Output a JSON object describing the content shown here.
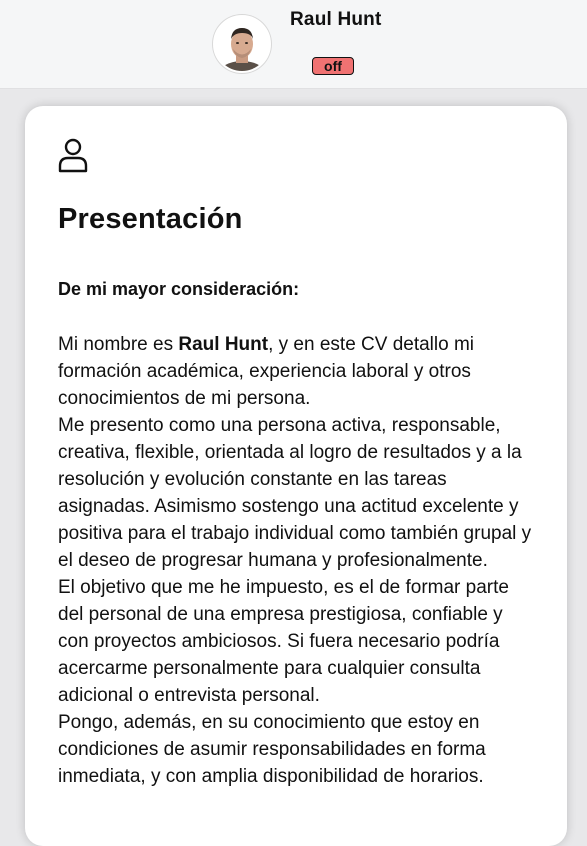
{
  "header": {
    "user_name": "Raul Hunt",
    "status": "off",
    "status_color": "#f07272"
  },
  "presentation": {
    "icon": "person-icon",
    "title": "Presentación",
    "salutation": "De mi mayor consideración:",
    "paragraph1_before": "Mi nombre es ",
    "paragraph1_name": "Raul Hunt",
    "paragraph1_after": ", y en este CV detallo mi formación académica, experiencia laboral y otros conocimientos de mi persona.",
    "paragraph2": "Me presento como una persona activa, responsable, creativa, flexible, orientada al logro de resultados y a la resolución y evolución constante en las tareas asignadas. Asimismo sostengo una actitud excelente y positiva para el trabajo individual como también grupal y el deseo de progresar humana y profesionalmente.",
    "paragraph3": "El objetivo que me he impuesto, es el de formar parte del personal de una empresa prestigiosa, confiable y con proyectos ambiciosos. Si fuera necesario podría acercarme personalmente para cualquier consulta adicional o entrevista personal.",
    "paragraph4": "Pongo, además, en su conocimiento que estoy en condiciones de asumir responsabilidades en forma inmediata, y con amplia disponibilidad de horarios."
  }
}
